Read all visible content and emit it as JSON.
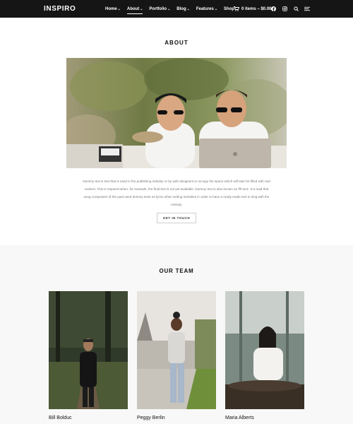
{
  "nav": {
    "logo": "INSPIRO",
    "items": [
      {
        "label": "Home",
        "dropdown": true,
        "active": false
      },
      {
        "label": "About",
        "dropdown": true,
        "active": true
      },
      {
        "label": "Portfolio",
        "dropdown": true,
        "active": false
      },
      {
        "label": "Blog",
        "dropdown": true,
        "active": false
      },
      {
        "label": "Features",
        "dropdown": true,
        "active": false
      },
      {
        "label": "Shop",
        "dropdown": false,
        "active": false
      }
    ],
    "cart_label": "0 items – $0.00",
    "icons": [
      "cart-icon",
      "facebook-icon",
      "instagram-icon",
      "search-icon",
      "hamburger-menu-icon"
    ]
  },
  "about": {
    "title": "ABOUT",
    "text": "Dummy text is text that is used in the publishing industry or by web designers to occupy the space which will later be filled with real content. This is required when, for example, the final text is not yet available. Dummy text is also known as 'fill text'. It is said that song composers of the past used dummy texts as lyrics when writing melodies in order to have a ready-made text to sing with the melody.",
    "button_label": "GET IN TOUCH"
  },
  "team": {
    "title": "OUR TEAM",
    "members": [
      {
        "name": "Bill Bolduc"
      },
      {
        "name": "Peggy Berlin"
      },
      {
        "name": "Maria Alberts"
      }
    ]
  },
  "colors": {
    "nav_bg": "#151515",
    "team_bg": "#f8f8f8",
    "text_muted": "#777777"
  }
}
